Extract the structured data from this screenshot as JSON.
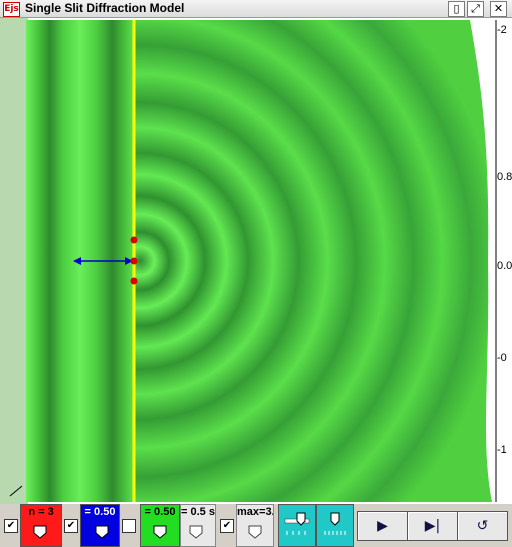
{
  "window": {
    "title": "Single Slit Diffraction Model",
    "icon_text": "Ejs",
    "buttons": [
      "▯",
      "⤢",
      "✕"
    ]
  },
  "plot": {
    "right_axis_ticks": [
      "-2",
      "0.8",
      "0.0",
      "-0",
      "-1"
    ]
  },
  "controls": {
    "n_label": "n = 3",
    "a_label": "= 0.50",
    "b_label": "= 0.50",
    "dt_label": "= 0.5 s",
    "max_label": "max=3.",
    "check1": "✔",
    "check2": "✔",
    "check3": "",
    "check4": "✔",
    "play_icon": "▶",
    "step_icon": "▶|",
    "reset_icon": "↺",
    "colors": {
      "red": "#ff1a1a",
      "blue": "#0000e0",
      "green": "#22dd22",
      "cyan": "#20c8c8"
    }
  }
}
